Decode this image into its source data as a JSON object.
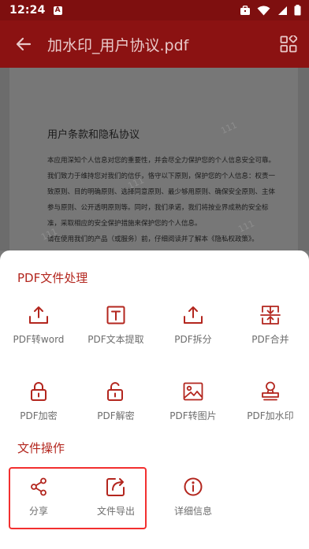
{
  "status_bar": {
    "time": "12:24",
    "app_notification_icon": "A",
    "icons": [
      "briefcase-icon",
      "wifi-icon",
      "signal-icon",
      "battery-icon"
    ]
  },
  "app_bar": {
    "title": "加水印_用户协议.pdf",
    "back_icon": "arrow-left-icon",
    "grid_icon": "grid-layout-icon"
  },
  "document": {
    "heading": "用户条款和隐私协议",
    "lines": [
      "本应用深知个人信息对您的重要性，并会尽全力保护您的个人信息安全可靠。",
      "我们致力于维持您对我们的信任，恪守以下原则，保护您的个人信息：权责一",
      "致原则、目的明确原则、选择同意原则、最少够用原则、确保安全原则、主体",
      "参与原则、公开透明原则等。同时，我们承诺，我们将按业界成熟的安全标",
      "准，采取相应的安全保护措施来保护您的个人信息。",
      "请在使用我们的产品（或服务）前，仔细阅读并了解本《隐私权政策》。"
    ],
    "watermark": "111"
  },
  "sheet": {
    "pdf_section_title": "PDF文件处理",
    "file_section_title": "文件操作",
    "pdf_tools": [
      {
        "label": "PDF转word",
        "icon": "upload-tray-icon"
      },
      {
        "label": "PDF文本提取",
        "icon": "text-box-icon"
      },
      {
        "label": "PDF拆分",
        "icon": "upload-tray-icon"
      },
      {
        "label": "PDF合并",
        "icon": "merge-icon"
      },
      {
        "label": "PDF加密",
        "icon": "lock-icon"
      },
      {
        "label": "PDF解密",
        "icon": "unlock-icon"
      },
      {
        "label": "PDF转图片",
        "icon": "image-icon"
      },
      {
        "label": "PDF加水印",
        "icon": "stamp-icon"
      }
    ],
    "file_tools": [
      {
        "label": "分享",
        "icon": "share-icon"
      },
      {
        "label": "文件导出",
        "icon": "export-icon"
      },
      {
        "label": "详细信息",
        "icon": "info-icon"
      }
    ]
  },
  "colors": {
    "status_bar": "#7e0f0f",
    "app_bar": "#8b1212",
    "accent": "#b3261e",
    "highlight": "#f22f2f",
    "label": "#6d6d6d"
  }
}
